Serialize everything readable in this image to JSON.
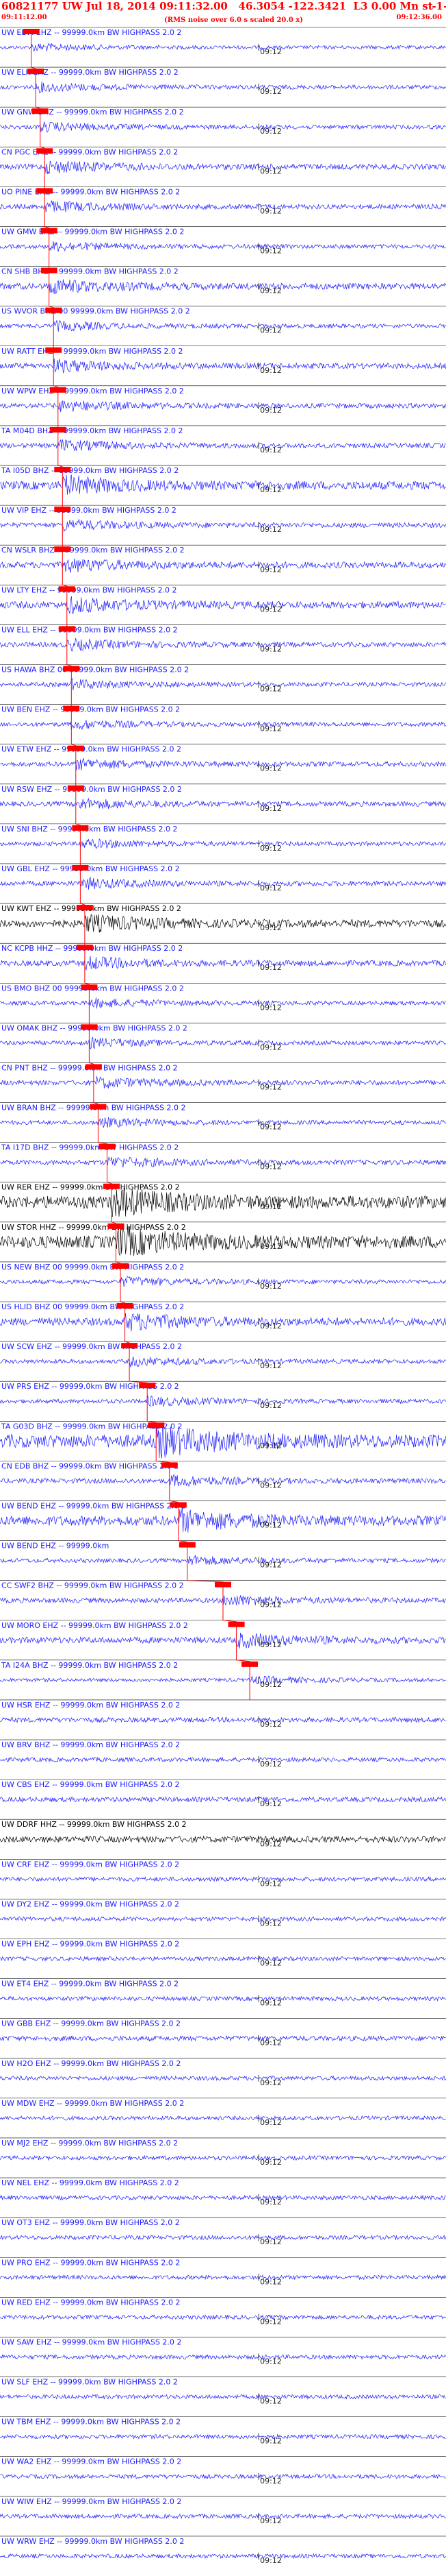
{
  "header": {
    "title": "60821177 UW Jul 18, 2014 09:11:32.00   46.3054 -122.3421  L3 0.00 Mn st   -----",
    "title_right": "-1",
    "start_time": "09:11:12.00",
    "end_time": "09:12:36.00",
    "subtitle": "(RMS noise over 6.0 s scaled 20.0 x)"
  },
  "chart_data": {
    "type": "line",
    "title": "60821177 UW Jul 18, 2014 09:11:32.00   46.3054 -122.3421  L3 0.00 Mn st   -----",
    "xlabel": "",
    "ylabel": "",
    "tick_label": "09:12",
    "pick_color": "#ff0000",
    "series": [
      {
        "name": "UW EDM EHZ -- 99999.0km BW  HIGHPASS  2.0  2",
        "color": "#1a1aff",
        "amplitude": 0.25,
        "pick": 0.07
      },
      {
        "name": "UW ELK EHZ -- 99999.0km BW  HIGHPASS  2.0  2",
        "color": "#1a1aff",
        "amplitude": 0.3,
        "pick": 0.08
      },
      {
        "name": "UW GNW BHZ -- 99999.0km BW  HIGHPASS  2.0  2",
        "color": "#1a1aff",
        "amplitude": 0.3,
        "pick": 0.09
      },
      {
        "name": "CN PGC EHZ -- 99999.0km BW  HIGHPASS  2.0  2",
        "color": "#1a1aff",
        "amplitude": 0.4,
        "pick": 0.1
      },
      {
        "name": "UO PINE EHZ -- 99999.0km BW  HIGHPASS  2.0  2",
        "color": "#1a1aff",
        "amplitude": 0.35,
        "pick": 0.1
      },
      {
        "name": "UW GMW EHZ -- 99999.0km BW  HIGHPASS  2.0  2",
        "color": "#1a1aff",
        "amplitude": 0.3,
        "pick": 0.11
      },
      {
        "name": "CN SHB BHZ -- 99999.0km BW  HIGHPASS  2.0  2",
        "color": "#1a1aff",
        "amplitude": 0.45,
        "pick": 0.11
      },
      {
        "name": "US WVOR BHZ 00 99999.0km BW  HIGHPASS  2.0  2",
        "color": "#1a1aff",
        "amplitude": 0.3,
        "pick": 0.12
      },
      {
        "name": "UW RATT EHZ -- 99999.0km BW  HIGHPASS  2.0  2",
        "color": "#1a1aff",
        "amplitude": 0.4,
        "pick": 0.12
      },
      {
        "name": "UW WPW EHZ -- 99999.0km BW  HIGHPASS  2.0  2",
        "color": "#1a1aff",
        "amplitude": 0.35,
        "pick": 0.13
      },
      {
        "name": "TA M04D BHZ -- 99999.0km BW  HIGHPASS  2.0  2",
        "color": "#1a1aff",
        "amplitude": 0.35,
        "pick": 0.13
      },
      {
        "name": "TA I05D BHZ -- 99999.0km BW  HIGHPASS  2.0  2",
        "color": "#1a1aff",
        "amplitude": 0.6,
        "pick": 0.14
      },
      {
        "name": "UW VIP EHZ -- 99999.0km BW  HIGHPASS  2.0  2",
        "color": "#1a1aff",
        "amplitude": 0.35,
        "pick": 0.14
      },
      {
        "name": "CN WSLR BHZ -- 99999.0km BW  HIGHPASS  2.0  2",
        "color": "#1a1aff",
        "amplitude": 0.45,
        "pick": 0.14
      },
      {
        "name": "UW LTY EHZ -- 99999.0km BW  HIGHPASS  2.0  2",
        "color": "#1a1aff",
        "amplitude": 0.5,
        "pick": 0.15
      },
      {
        "name": "UW ELL EHZ -- 99999.0km BW  HIGHPASS  2.0  2",
        "color": "#1a1aff",
        "amplitude": 0.35,
        "pick": 0.15
      },
      {
        "name": "US HAWA BHZ 00 99999.0km BW  HIGHPASS  2.0  2",
        "color": "#1a1aff",
        "amplitude": 0.3,
        "pick": 0.16
      },
      {
        "name": "UW BEN EHZ -- 99999.0km BW  HIGHPASS  2.0  2",
        "color": "#1a1aff",
        "amplitude": 0.3,
        "pick": 0.16
      },
      {
        "name": "UW ETW EHZ -- 99999.0km BW  HIGHPASS  2.0  2",
        "color": "#1a1aff",
        "amplitude": 0.35,
        "pick": 0.17
      },
      {
        "name": "UW RSW EHZ -- 99999.0km BW  HIGHPASS  2.0  2",
        "color": "#1a1aff",
        "amplitude": 0.35,
        "pick": 0.17
      },
      {
        "name": "UW SNI BHZ -- 99999.0km BW  HIGHPASS  2.0  2",
        "color": "#1a1aff",
        "amplitude": 0.3,
        "pick": 0.18
      },
      {
        "name": "UW GBL EHZ -- 99999.0km BW  HIGHPASS  2.0  2",
        "color": "#1a1aff",
        "amplitude": 0.35,
        "pick": 0.18
      },
      {
        "name": "UW KWT EHZ -- 99999.0km BW  HIGHPASS  2.0  2",
        "color": "#000000",
        "amplitude": 0.55,
        "pick": 0.19
      },
      {
        "name": "NC KCPB HHZ -- 99999.0km BW  HIGHPASS  2.0  2",
        "color": "#1a1aff",
        "amplitude": 0.4,
        "pick": 0.19
      },
      {
        "name": "US BMO BHZ 00 99999.0km BW  HIGHPASS  2.0  2",
        "color": "#1a1aff",
        "amplitude": 0.3,
        "pick": 0.2
      },
      {
        "name": "UW OMAK BHZ -- 99999.0km BW  HIGHPASS  2.0  2",
        "color": "#1a1aff",
        "amplitude": 0.3,
        "pick": 0.2
      },
      {
        "name": "CN PNT BHZ -- 99999.0km BW  HIGHPASS  2.0  2",
        "color": "#1a1aff",
        "amplitude": 0.35,
        "pick": 0.21
      },
      {
        "name": "UW BRAN BHZ -- 99999.0km BW  HIGHPASS  2.0  2",
        "color": "#1a1aff",
        "amplitude": 0.3,
        "pick": 0.22
      },
      {
        "name": "TA I17D BHZ -- 99999.0km BW  HIGHPASS  2.0  2",
        "color": "#1a1aff",
        "amplitude": 0.35,
        "pick": 0.24
      },
      {
        "name": "UW RER EHZ -- 99999.0km BW  HIGHPASS  2.0  2",
        "color": "#000000",
        "amplitude": 0.9,
        "pick": 0.25
      },
      {
        "name": "UW STOR HHZ -- 99999.0km BW  HIGHPASS  2.0  2",
        "color": "#000000",
        "amplitude": 0.9,
        "pick": 0.26
      },
      {
        "name": "US NEW BHZ 00 99999.0km BW  HIGHPASS  2.0  2",
        "color": "#1a1aff",
        "amplitude": 0.3,
        "pick": 0.27
      },
      {
        "name": "US HLID BHZ 00 99999.0km BW  HIGHPASS  2.0  2",
        "color": "#1a1aff",
        "amplitude": 0.55,
        "pick": 0.28
      },
      {
        "name": "UW SCW EHZ -- 99999.0km BW  HIGHPASS  2.0  2",
        "color": "#1a1aff",
        "amplitude": 0.3,
        "pick": 0.29
      },
      {
        "name": "UW PRS EHZ -- 99999.0km BW  HIGHPASS  2.0  2",
        "color": "#1a1aff",
        "amplitude": 0.3,
        "pick": 0.33
      },
      {
        "name": "TA G03D BHZ -- 99999.0km BW  HIGHPASS  2.0  2",
        "color": "#1a1aff",
        "amplitude": 0.95,
        "pick": 0.35
      },
      {
        "name": "CN EDB BHZ -- 99999.0km BW  HIGHPASS  2.0  2",
        "color": "#1a1aff",
        "amplitude": 0.35,
        "pick": 0.38
      },
      {
        "name": "UW BEND EHZ -- 99999.0km BW  HIGHPASS  2.0  2",
        "color": "#1a1aff",
        "amplitude": 0.7,
        "pick": 0.4
      },
      {
        "name": "UW BEND EHZ -- 99999.0km",
        "color": "#1a1aff",
        "amplitude": 0.3,
        "pick": 0.42
      },
      {
        "name": "CC SWF2 BHZ -- 99999.0km BW  HIGHPASS  2.0  2",
        "color": "#1a1aff",
        "amplitude": 0.35,
        "pick": 0.5
      },
      {
        "name": "UW MORO EHZ -- 99999.0km BW  HIGHPASS  2.0  2",
        "color": "#1a1aff",
        "amplitude": 0.45,
        "pick": 0.53
      },
      {
        "name": "TA I24A BHZ -- 99999.0km BW  HIGHPASS  2.0  2",
        "color": "#1a1aff",
        "amplitude": 0.25,
        "pick": 0.56
      },
      {
        "name": "UW HSR EHZ -- 99999.0km BW  HIGHPASS  2.0  2",
        "color": "#1a1aff",
        "amplitude": 0.35,
        "pick": null
      },
      {
        "name": "UW BRV BHZ -- 99999.0km BW  HIGHPASS  2.0  2",
        "color": "#1a1aff",
        "amplitude": 0.3,
        "pick": null
      },
      {
        "name": "UW CBS EHZ -- 99999.0km BW  HIGHPASS  2.0  2",
        "color": "#1a1aff",
        "amplitude": 0.35,
        "pick": null
      },
      {
        "name": "UW DDRF HHZ -- 99999.0km BW  HIGHPASS  2.0  2",
        "color": "#000000",
        "amplitude": 0.45,
        "pick": null
      },
      {
        "name": "UW CRF EHZ -- 99999.0km BW  HIGHPASS  2.0  2",
        "color": "#1a1aff",
        "amplitude": 0.3,
        "pick": null
      },
      {
        "name": "UW DY2 EHZ -- 99999.0km BW  HIGHPASS  2.0  2",
        "color": "#1a1aff",
        "amplitude": 0.3,
        "pick": null
      },
      {
        "name": "UW EPH EHZ -- 99999.0km BW  HIGHPASS  2.0  2",
        "color": "#1a1aff",
        "amplitude": 0.3,
        "pick": null
      },
      {
        "name": "UW ET4 EHZ -- 99999.0km BW  HIGHPASS  2.0  2",
        "color": "#1a1aff",
        "amplitude": 0.3,
        "pick": null
      },
      {
        "name": "UW GBB EHZ -- 99999.0km BW  HIGHPASS  2.0  2",
        "color": "#1a1aff",
        "amplitude": 0.35,
        "pick": null
      },
      {
        "name": "UW H2O EHZ -- 99999.0km BW  HIGHPASS  2.0  2",
        "color": "#1a1aff",
        "amplitude": 0.3,
        "pick": null
      },
      {
        "name": "UW MDW EHZ -- 99999.0km BW  HIGHPASS  2.0  2",
        "color": "#1a1aff",
        "amplitude": 0.3,
        "pick": null
      },
      {
        "name": "UW MJ2 EHZ -- 99999.0km BW  HIGHPASS  2.0  2",
        "color": "#1a1aff",
        "amplitude": 0.3,
        "pick": null
      },
      {
        "name": "UW NEL EHZ -- 99999.0km BW  HIGHPASS  2.0  2",
        "color": "#1a1aff",
        "amplitude": 0.3,
        "pick": null
      },
      {
        "name": "UW OT3 EHZ -- 99999.0km BW  HIGHPASS  2.0  2",
        "color": "#1a1aff",
        "amplitude": 0.3,
        "pick": null
      },
      {
        "name": "UW PRO EHZ -- 99999.0km BW  HIGHPASS  2.0  2",
        "color": "#1a1aff",
        "amplitude": 0.3,
        "pick": null
      },
      {
        "name": "UW RED EHZ -- 99999.0km BW  HIGHPASS  2.0  2",
        "color": "#1a1aff",
        "amplitude": 0.3,
        "pick": null
      },
      {
        "name": "UW SAW EHZ -- 99999.0km BW  HIGHPASS  2.0  2",
        "color": "#1a1aff",
        "amplitude": 0.3,
        "pick": null
      },
      {
        "name": "UW SLF EHZ -- 99999.0km BW  HIGHPASS  2.0  2",
        "color": "#1a1aff",
        "amplitude": 0.3,
        "pick": null
      },
      {
        "name": "UW TBM EHZ -- 99999.0km BW  HIGHPASS  2.0  2",
        "color": "#1a1aff",
        "amplitude": 0.3,
        "pick": null
      },
      {
        "name": "UW WA2 EHZ -- 99999.0km BW  HIGHPASS  2.0  2",
        "color": "#1a1aff",
        "amplitude": 0.3,
        "pick": null
      },
      {
        "name": "UW WIW EHZ -- 99999.0km BW  HIGHPASS  2.0  2",
        "color": "#1a1aff",
        "amplitude": 0.3,
        "pick": null
      },
      {
        "name": "UW WRW EHZ -- 99999.0km BW  HIGHPASS  2.0  2",
        "color": "#1a1aff",
        "amplitude": 0.3,
        "pick": null
      }
    ]
  }
}
